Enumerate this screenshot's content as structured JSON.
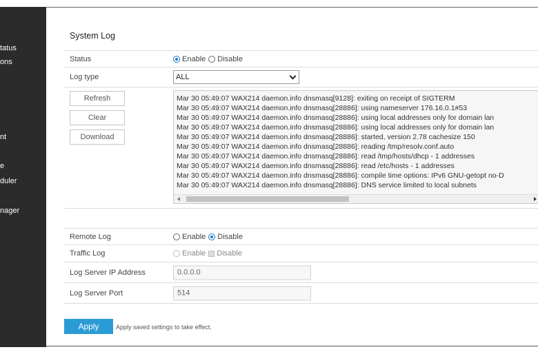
{
  "sidebar": {
    "items": [
      {
        "label": "tatus"
      },
      {
        "label": "ons"
      },
      {
        "label": "nt"
      },
      {
        "label": "e"
      },
      {
        "label": "duler"
      },
      {
        "label": "nager"
      }
    ]
  },
  "page": {
    "title": "System Log"
  },
  "status": {
    "label": "Status",
    "enable": "Enable",
    "disable": "Disable",
    "selected": "Enable"
  },
  "log_type": {
    "label": "Log type",
    "value": "ALL"
  },
  "log_buttons": {
    "refresh": "Refresh",
    "clear": "Clear",
    "download": "Download"
  },
  "log_lines": [
    "Mar 30 05:49:07 WAX214 daemon.info dnsmasq[9128]: exiting on receipt of SIGTERM",
    "Mar 30 05:49:07 WAX214 daemon.info dnsmasq[28886]: using nameserver 176.16.0.1#53",
    "Mar 30 05:49:07 WAX214 daemon.info dnsmasq[28886]: using local addresses only for domain lan",
    "Mar 30 05:49:07 WAX214 daemon.info dnsmasq[28886]: using local addresses only for domain lan",
    "Mar 30 05:49:07 WAX214 daemon.info dnsmasq[28886]: started, version 2.78 cachesize 150",
    "Mar 30 05:49:07 WAX214 daemon.info dnsmasq[28886]: reading /tmp/resolv.conf.auto",
    "Mar 30 05:49:07 WAX214 daemon.info dnsmasq[28886]: read /tmp/hosts/dhcp - 1 addresses",
    "Mar 30 05:49:07 WAX214 daemon.info dnsmasq[28886]: read /etc/hosts - 1 addresses",
    "Mar 30 05:49:07 WAX214 daemon.info dnsmasq[28886]: compile time options: IPv6 GNU-getopt no-D",
    "Mar 30 05:49:07 WAX214 daemon.info dnsmasq[28886]: DNS service limited to local subnets"
  ],
  "remote_log": {
    "label": "Remote Log",
    "enable": "Enable",
    "disable": "Disable",
    "selected": "Disable"
  },
  "traffic_log": {
    "label": "Traffic Log",
    "enable": "Enable",
    "disable": "Disable"
  },
  "log_server_ip": {
    "label": "Log Server IP Address",
    "value": "0.0.0.0"
  },
  "log_server_port": {
    "label": "Log Server Port",
    "value": "514"
  },
  "apply": {
    "label": "Apply",
    "hint": "Apply saved settings to take effect."
  },
  "colors": {
    "accent": "#2b9bd6",
    "radio": "#1a73c9",
    "sidebar": "#2b2b2b"
  }
}
